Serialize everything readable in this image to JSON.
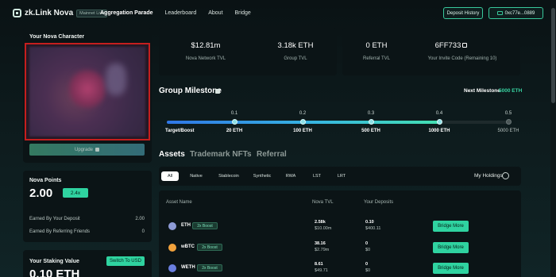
{
  "nav": {
    "brand": "zk.Link Nova",
    "badge": "Mainnet Live",
    "links": [
      "Aggregation Parade",
      "Leaderboard",
      "About",
      "Bridge"
    ],
    "history_button": "Deposit History",
    "wallet_button": "0xc77e...0889"
  },
  "character": {
    "title": "Your Nova Character",
    "upgrade_button": "Upgrade"
  },
  "points": {
    "title": "Nova Points",
    "value": "2.00",
    "boost": "2.4x",
    "rows": [
      {
        "label": "Earned By Your Deposit",
        "value": "2.00"
      },
      {
        "label": "Earned By Referring Friends",
        "value": "0"
      }
    ]
  },
  "staking": {
    "title": "Your Staking Value",
    "switch_button": "Switch To USD",
    "value": "0.10 ETH"
  },
  "stats": {
    "left": [
      {
        "value": "$12.81m",
        "label": "Nova Network TVL"
      },
      {
        "value": "3.18k ETH",
        "label": "Group TVL"
      }
    ],
    "right": [
      {
        "value": "0 ETH",
        "label": "Referral TVL"
      },
      {
        "value": "6FF733",
        "label": "Your Invite Code (Remaining 10)"
      }
    ]
  },
  "milestone": {
    "title": "Group Milestone",
    "next_label": "Next Milestone",
    "next_value": "5000 ETH",
    "target_label": "Target/Boost",
    "progress": 0.8,
    "steps": [
      {
        "boost": "0.1",
        "target": "20 ETH",
        "reached": true
      },
      {
        "boost": "0.2",
        "target": "100 ETH",
        "reached": true
      },
      {
        "boost": "0.3",
        "target": "500 ETH",
        "reached": true
      },
      {
        "boost": "0.4",
        "target": "1000 ETH",
        "reached": true
      },
      {
        "boost": "0.5",
        "target": "5000 ETH",
        "reached": false
      }
    ]
  },
  "tabs": [
    "Assets",
    "Trademark NFTs",
    "Referral"
  ],
  "filters": [
    "All",
    "Native",
    "Stablecoin",
    "Synthetic",
    "RWA",
    "LST",
    "LRT"
  ],
  "holdings_label": "My Holdings",
  "table": {
    "headers": [
      "Asset Name",
      "Nova TVL",
      "Your Deposits"
    ],
    "rows": [
      {
        "token": "ETH",
        "boost": "2x Boost",
        "tvl_amount": "2.58k",
        "tvl_usd": "$10.00m",
        "dep_amount": "0.10",
        "dep_usd": "$400.11",
        "action": "Bridge More",
        "icon_color": "#8e9bd6"
      },
      {
        "token": "wBTC",
        "boost": "2x Boost",
        "tvl_amount": "38.16",
        "tvl_usd": "$2.79m",
        "dep_amount": "0",
        "dep_usd": "$0",
        "action": "Bridge More",
        "icon_color": "#f2a23c"
      },
      {
        "token": "WETH",
        "boost": "2x Boost",
        "tvl_amount": "8.61",
        "tvl_usd": "$49.71",
        "dep_amount": "0",
        "dep_usd": "$0",
        "action": "Bridge More",
        "icon_color": "#6a7fe0"
      }
    ]
  }
}
